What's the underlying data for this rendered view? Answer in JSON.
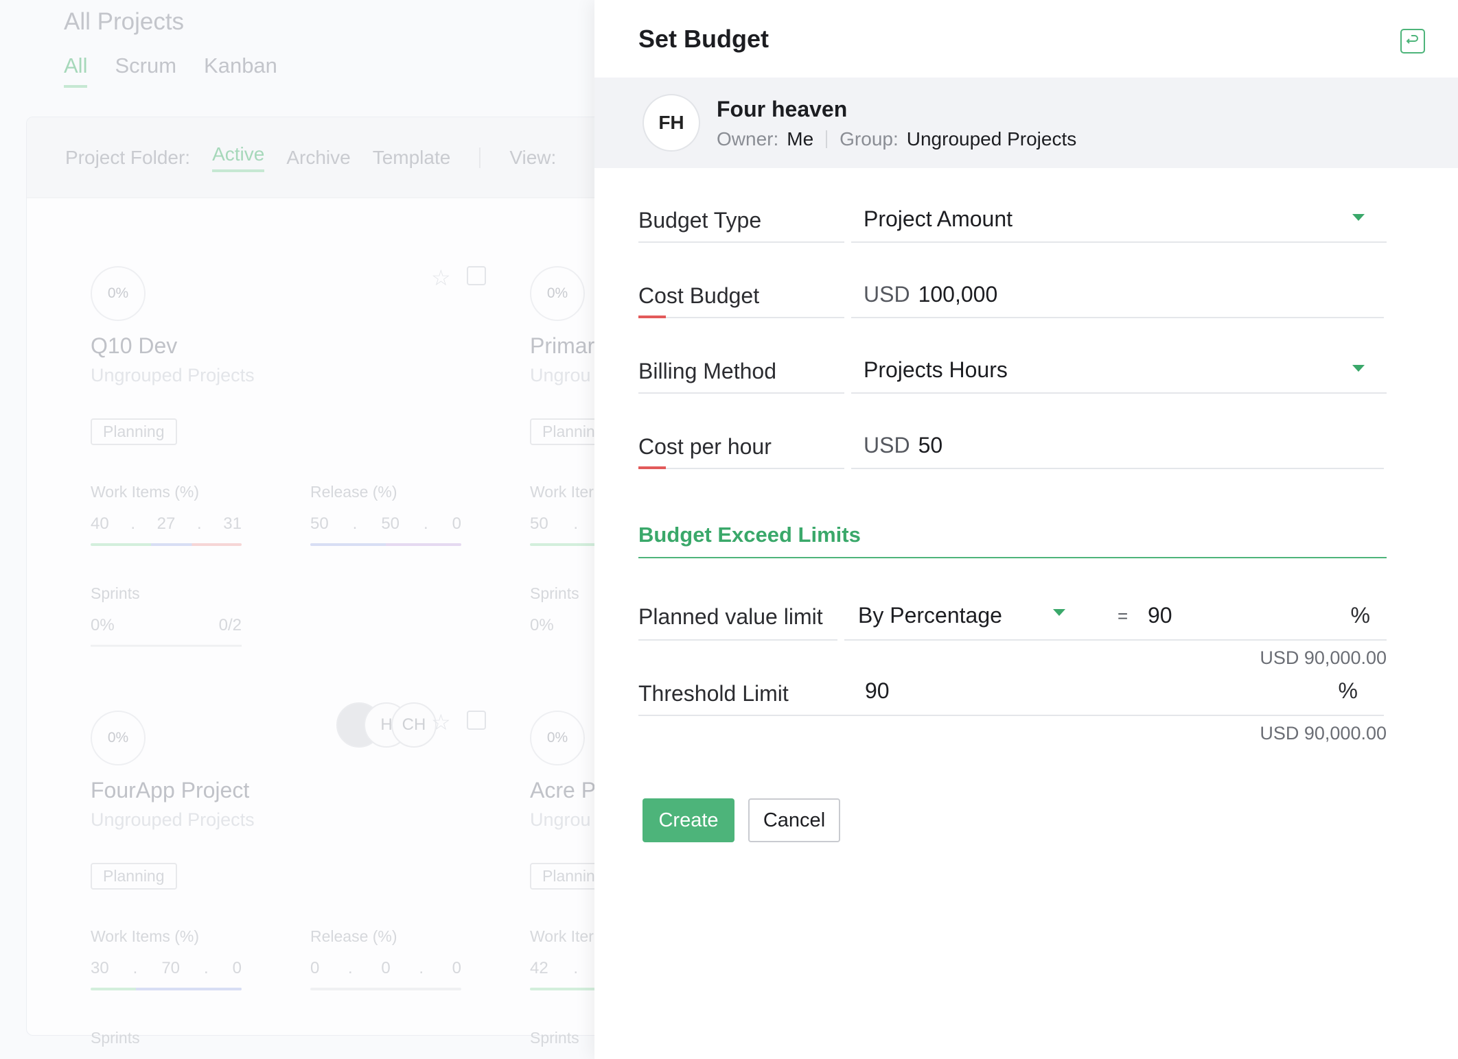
{
  "background": {
    "page_title": "All Projects",
    "type_tabs": [
      "All",
      "Scrum",
      "Kanban"
    ],
    "folder_label": "Project Folder:",
    "folder_tabs": [
      "Active",
      "Archive",
      "Template"
    ],
    "view_label": "View:",
    "cards": [
      {
        "progress": "0%",
        "name": "Q10 Dev",
        "group": "Ungrouped Projects",
        "status": "Planning",
        "work_label": "Work Items (%)",
        "work": [
          "40",
          ".",
          "27",
          ".",
          "31"
        ],
        "release_label": "Release (%)",
        "release": [
          "50",
          ".",
          "50",
          ".",
          "0"
        ],
        "sprints_label": "Sprints",
        "sprints": [
          "0%",
          "0/2"
        ],
        "avatars": [
          "",
          "H",
          "CH"
        ]
      },
      {
        "progress": "0%",
        "name": "Primar",
        "group": "Ungrou",
        "status": "Plannin",
        "work_label": "Work Iter",
        "work": [
          "50",
          "."
        ],
        "sprints_label": "Sprints",
        "sprints": [
          "0%"
        ]
      },
      {
        "progress": "0%",
        "name": "FourApp Project",
        "group": "Ungrouped Projects",
        "status": "Planning",
        "work_label": "Work Items (%)",
        "work": [
          "30",
          ".",
          "70",
          ".",
          "0"
        ],
        "release_label": "Release (%)",
        "release": [
          "0",
          ".",
          "0",
          ".",
          "0"
        ],
        "sprints_label": "Sprints"
      },
      {
        "progress": "0%",
        "name": "Acre Pr",
        "group": "Ungrou",
        "status": "Plannin",
        "work_label": "Work Iter",
        "work": [
          "42",
          "."
        ],
        "sprints_label": "Sprints"
      }
    ]
  },
  "drawer": {
    "title": "Set Budget",
    "project": {
      "initials": "FH",
      "name": "Four heaven",
      "owner_label": "Owner:",
      "owner": "Me",
      "group_label": "Group:",
      "group": "Ungrouped Projects"
    },
    "fields": {
      "budget_type": {
        "label": "Budget Type",
        "value": "Project Amount"
      },
      "cost_budget": {
        "label": "Cost Budget",
        "currency": "USD",
        "value": "100,000"
      },
      "billing_method": {
        "label": "Billing Method",
        "value": "Projects Hours"
      },
      "cost_per_hour": {
        "label": "Cost per hour",
        "currency": "USD",
        "value": "50"
      }
    },
    "section_title": "Budget Exceed Limits",
    "planned": {
      "label": "Planned value limit",
      "mode": "By Percentage",
      "eq": "=",
      "value": "90",
      "unit": "%",
      "amount": "USD 90,000.00"
    },
    "threshold": {
      "label": "Threshold Limit",
      "value": "90",
      "unit": "%",
      "amount": "USD 90,000.00"
    },
    "create_label": "Create",
    "cancel_label": "Cancel"
  },
  "colors": {
    "accent": "#4db47a",
    "required": "#e25a5a"
  }
}
